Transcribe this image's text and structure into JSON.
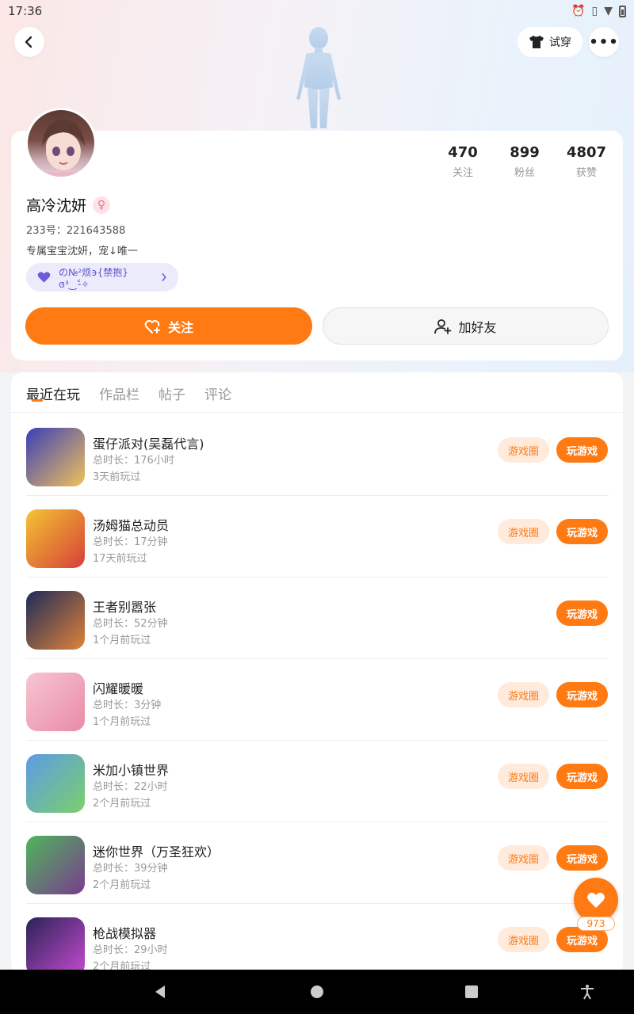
{
  "status_bar": {
    "time": "17:36"
  },
  "header": {
    "tryon_label": "试穿"
  },
  "profile": {
    "stats": [
      {
        "value": "470",
        "label": "关注"
      },
      {
        "value": "899",
        "label": "粉丝"
      },
      {
        "value": "4807",
        "label": "获赞"
      }
    ],
    "nickname": "高冷沈妍",
    "gender_symbol": "♀",
    "uid": "233号：221643588",
    "bio": "专属宝宝沈妍，宠↓唯一",
    "relation": "の№²烦϶{禁抱}ɞ³‿˂̵✧",
    "follow_label": "关注",
    "add_friend_label": "加好友"
  },
  "tabs": [
    "最近在玩",
    "作品栏",
    "帖子",
    "评论"
  ],
  "games": [
    {
      "name": "蛋仔派对(吴磊代言)",
      "duration": "总时长：176小时",
      "last_played": "3天前玩过",
      "has_circle": true,
      "colors": [
        "#3a3fb8",
        "#f1c15a"
      ]
    },
    {
      "name": "汤姆猫总动员",
      "duration": "总时长：17分钟",
      "last_played": "17天前玩过",
      "has_circle": true,
      "colors": [
        "#f4c431",
        "#d6403a"
      ]
    },
    {
      "name": "王者别嚣张",
      "duration": "总时长：52分钟",
      "last_played": "1个月前玩过",
      "has_circle": false,
      "colors": [
        "#1d2b57",
        "#e0833a"
      ]
    },
    {
      "name": "闪耀暖暖",
      "duration": "总时长：3分钟",
      "last_played": "1个月前玩过",
      "has_circle": true,
      "colors": [
        "#f7c5d2",
        "#e98aa6"
      ]
    },
    {
      "name": "米加小镇世界",
      "duration": "总时长：22小时",
      "last_played": "2个月前玩过",
      "has_circle": true,
      "colors": [
        "#5b9be8",
        "#7ccf6a"
      ]
    },
    {
      "name": "迷你世界（万圣狂欢）",
      "duration": "总时长：39分钟",
      "last_played": "2个月前玩过",
      "has_circle": true,
      "colors": [
        "#4fb55a",
        "#7a3c8f"
      ]
    },
    {
      "name": "枪战模拟器",
      "duration": "总时长：29小时",
      "last_played": "2个月前玩过",
      "has_circle": true,
      "colors": [
        "#2a2357",
        "#c54bd0"
      ]
    }
  ],
  "buttons": {
    "circle_label": "游戏圈",
    "play_label": "玩游戏"
  },
  "like_fab": {
    "count": "973"
  },
  "colors": {
    "accent": "#ff7a13",
    "accent_light": "#ffeadb"
  }
}
